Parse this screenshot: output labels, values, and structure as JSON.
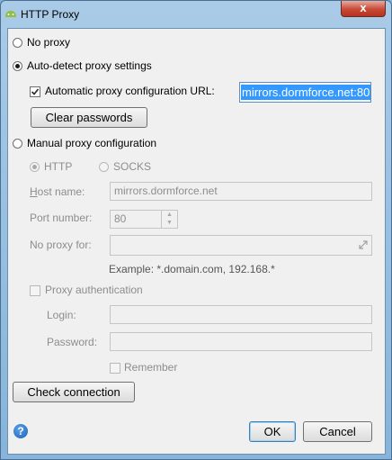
{
  "window": {
    "title": "HTTP Proxy",
    "close_glyph": "x"
  },
  "proxy_mode": {
    "no_proxy_label": "No proxy",
    "auto_detect_label": "Auto-detect proxy settings",
    "manual_label": "Manual proxy configuration",
    "selected": "auto-detect"
  },
  "auto": {
    "pac_checkbox_label": "Automatic proxy configuration URL:",
    "pac_checked": true,
    "pac_url": "mirrors.dormforce.net:80",
    "clear_passwords_label": "Clear passwords"
  },
  "manual": {
    "http_label": "HTTP",
    "socks_label": "SOCKS",
    "host_label": "Host name:",
    "host_value": "mirrors.dormforce.net",
    "port_label": "Port number:",
    "port_value": "80",
    "no_proxy_for_label": "No proxy for:",
    "no_proxy_for_value": "",
    "example_text": "Example: *.domain.com, 192.168.*",
    "auth_label": "Proxy authentication",
    "login_label": "Login:",
    "login_value": "",
    "password_label": "Password:",
    "password_value": "",
    "remember_label": "Remember"
  },
  "footer": {
    "check_connection_label": "Check connection",
    "ok_label": "OK",
    "cancel_label": "Cancel",
    "help_glyph": "?"
  }
}
